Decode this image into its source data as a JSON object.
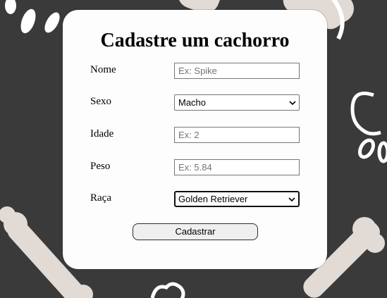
{
  "form": {
    "title": "Cadastre um cachorro",
    "fields": [
      {
        "label": "Nome",
        "type": "text",
        "value": "",
        "placeholder": "Ex: Spike"
      },
      {
        "label": "Sexo",
        "type": "select",
        "value": "Macho"
      },
      {
        "label": "Idade",
        "type": "text",
        "value": "",
        "placeholder": "Ex: 2"
      },
      {
        "label": "Peso",
        "type": "text",
        "value": "",
        "placeholder": "Ex: 5.84"
      },
      {
        "label": "Raça",
        "type": "select",
        "value": "Golden Retriever"
      }
    ],
    "submit_label": "Cadastrar"
  },
  "colors": {
    "background": "#3a3a3a",
    "pattern": "#e2dad4",
    "card": "#fdfdfd"
  },
  "icons": [
    "paw-print-icon",
    "bone-icon",
    "chevron-down-icon"
  ]
}
